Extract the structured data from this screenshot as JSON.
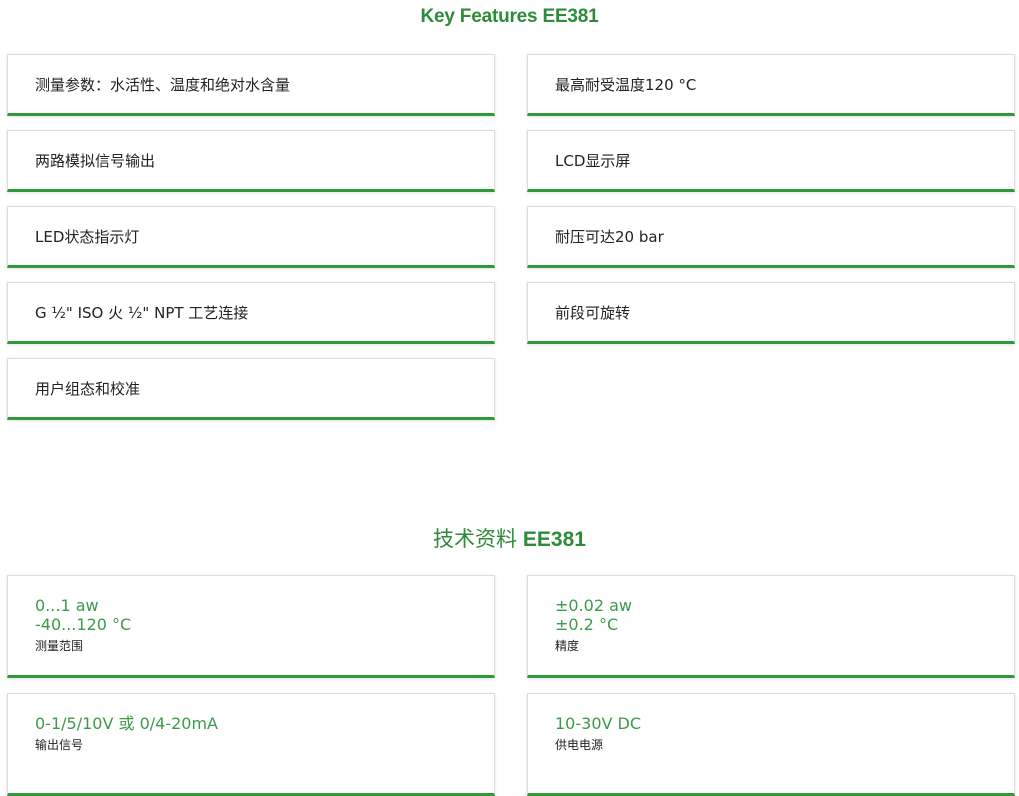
{
  "features": {
    "title": "Key Features EE381",
    "items": [
      "测量参数：水活性、温度和绝对水含量",
      "最高耐受温度120 °C",
      "两路模拟信号输出",
      "LCD显示屏",
      "LED状态指示灯",
      "耐压可达20 bar",
      "G ½\" ISO 火 ½\" NPT 工艺连接",
      "前段可旋转",
      "用户组态和校准"
    ]
  },
  "specs": {
    "title_cn": "技术资料 ",
    "title_en": "EE381",
    "items": [
      {
        "value_lines": [
          "0...1 aw",
          "-40...120 °C"
        ],
        "label": "测量范围"
      },
      {
        "value_lines": [
          "±0.02 aw",
          "±0.2 °C"
        ],
        "label": "精度"
      },
      {
        "value_lines": [
          "0-1/5/10V 或 0/4-20mA"
        ],
        "label": "输出信号"
      },
      {
        "value_lines": [
          "10-30V DC"
        ],
        "label": "供电电源"
      }
    ]
  }
}
